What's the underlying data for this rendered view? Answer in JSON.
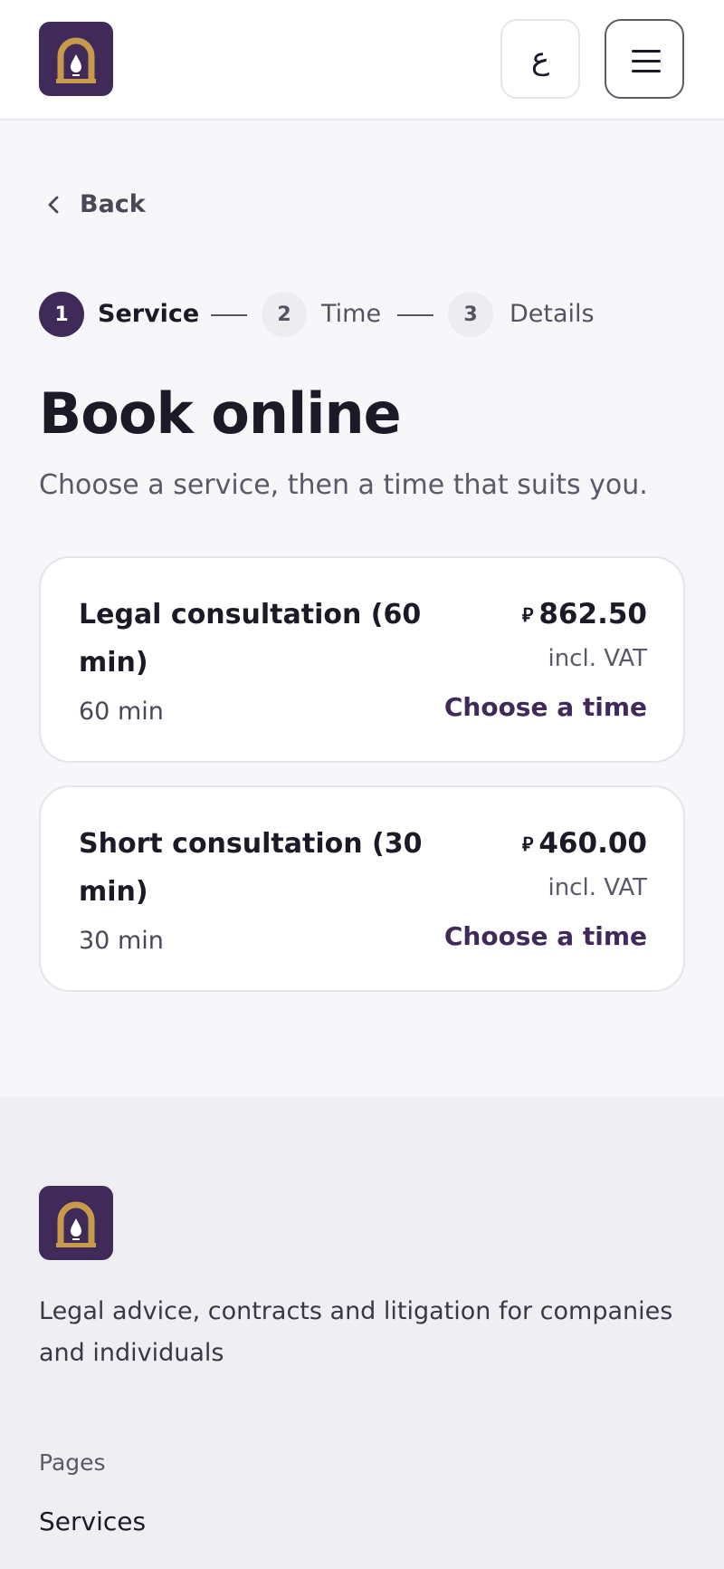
{
  "colors": {
    "brand": "#3f2a5a",
    "logo_gold": "#c89a4a",
    "background": "#f7f7fa",
    "footer_background": "#efeff3"
  },
  "header": {
    "lang_toggle_label": "ع",
    "logo_icon": "arch-lamp-icon",
    "menu_icon": "hamburger-menu-icon"
  },
  "nav": {
    "back_label": "Back",
    "back_icon": "chevron-left-icon"
  },
  "stepper": {
    "steps": [
      {
        "number": "1",
        "label": "Service",
        "state": "active"
      },
      {
        "number": "2",
        "label": "Time",
        "state": "inactive"
      },
      {
        "number": "3",
        "label": "Details",
        "state": "inactive"
      }
    ]
  },
  "main": {
    "title": "Book online",
    "subtitle": "Choose a service, then a time that suits you."
  },
  "services": [
    {
      "name": "Legal consultation (60 min)",
      "duration": "60 min",
      "currency": "⃁",
      "price": "862.50",
      "vat_note": "incl. VAT",
      "action": "Choose a time"
    },
    {
      "name": "Short consultation (30 min)",
      "duration": "30 min",
      "currency": "⃁",
      "price": "460.00",
      "vat_note": "incl. VAT",
      "action": "Choose a time"
    }
  ],
  "footer": {
    "tagline": "Legal advice, contracts and litigation for companies and individuals",
    "pages_heading": "Pages",
    "links": [
      "Services"
    ]
  }
}
